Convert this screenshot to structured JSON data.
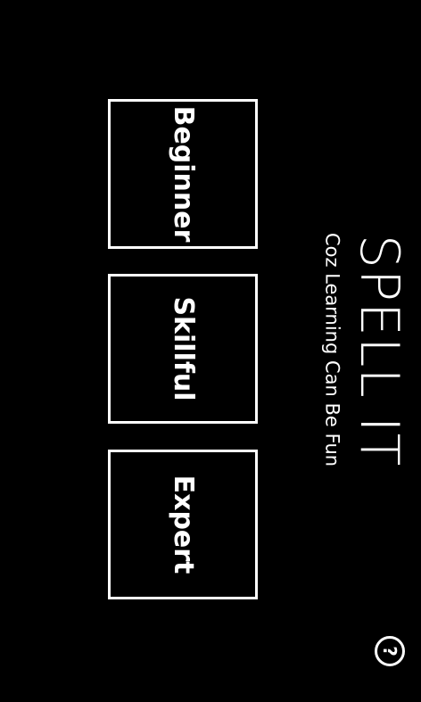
{
  "app": {
    "title": "SPELL IT",
    "tagline": "Coz Learning Can Be Fun"
  },
  "levels": [
    {
      "label": "Beginner"
    },
    {
      "label": "Skillful"
    },
    {
      "label": "Expert"
    }
  ],
  "help": {
    "glyph": "?",
    "icon": "help-icon"
  },
  "colors": {
    "background": "#000000",
    "foreground": "#ffffff"
  }
}
